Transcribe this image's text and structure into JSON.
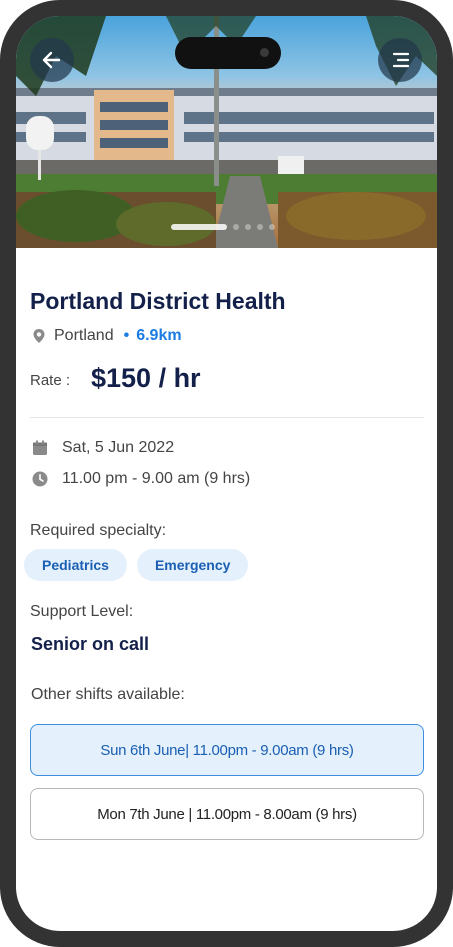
{
  "header": {
    "back_icon": "arrow-left-icon",
    "menu_icon": "menu-icon"
  },
  "facility": {
    "name": "Portland District Health",
    "location": "Portland",
    "distance": "6.9km",
    "location_icon": "map-pin-icon"
  },
  "rate": {
    "label": "Rate :",
    "value": "$150 / hr"
  },
  "schedule": {
    "date": "Sat, 5 Jun 2022",
    "time": "11.00 pm - 9.00 am (9 hrs)",
    "date_icon": "calendar-icon",
    "time_icon": "clock-icon"
  },
  "specialty": {
    "label": "Required specialty:",
    "items": [
      "Pediatrics",
      "Emergency"
    ]
  },
  "support": {
    "label": "Support Level:",
    "value": "Senior on call"
  },
  "other_shifts": {
    "label": "Other shifts available:",
    "items": [
      "Sun 6th June| 11.00pm - 9.00am (9 hrs)",
      "Mon 7th June | 11.00pm - 8.00am (9 hrs)"
    ],
    "selected_index": 0
  },
  "colors": {
    "primary": "#1b7ce4",
    "title": "#13204a",
    "chip_bg": "#e4f0fb",
    "frame": "#333333"
  }
}
